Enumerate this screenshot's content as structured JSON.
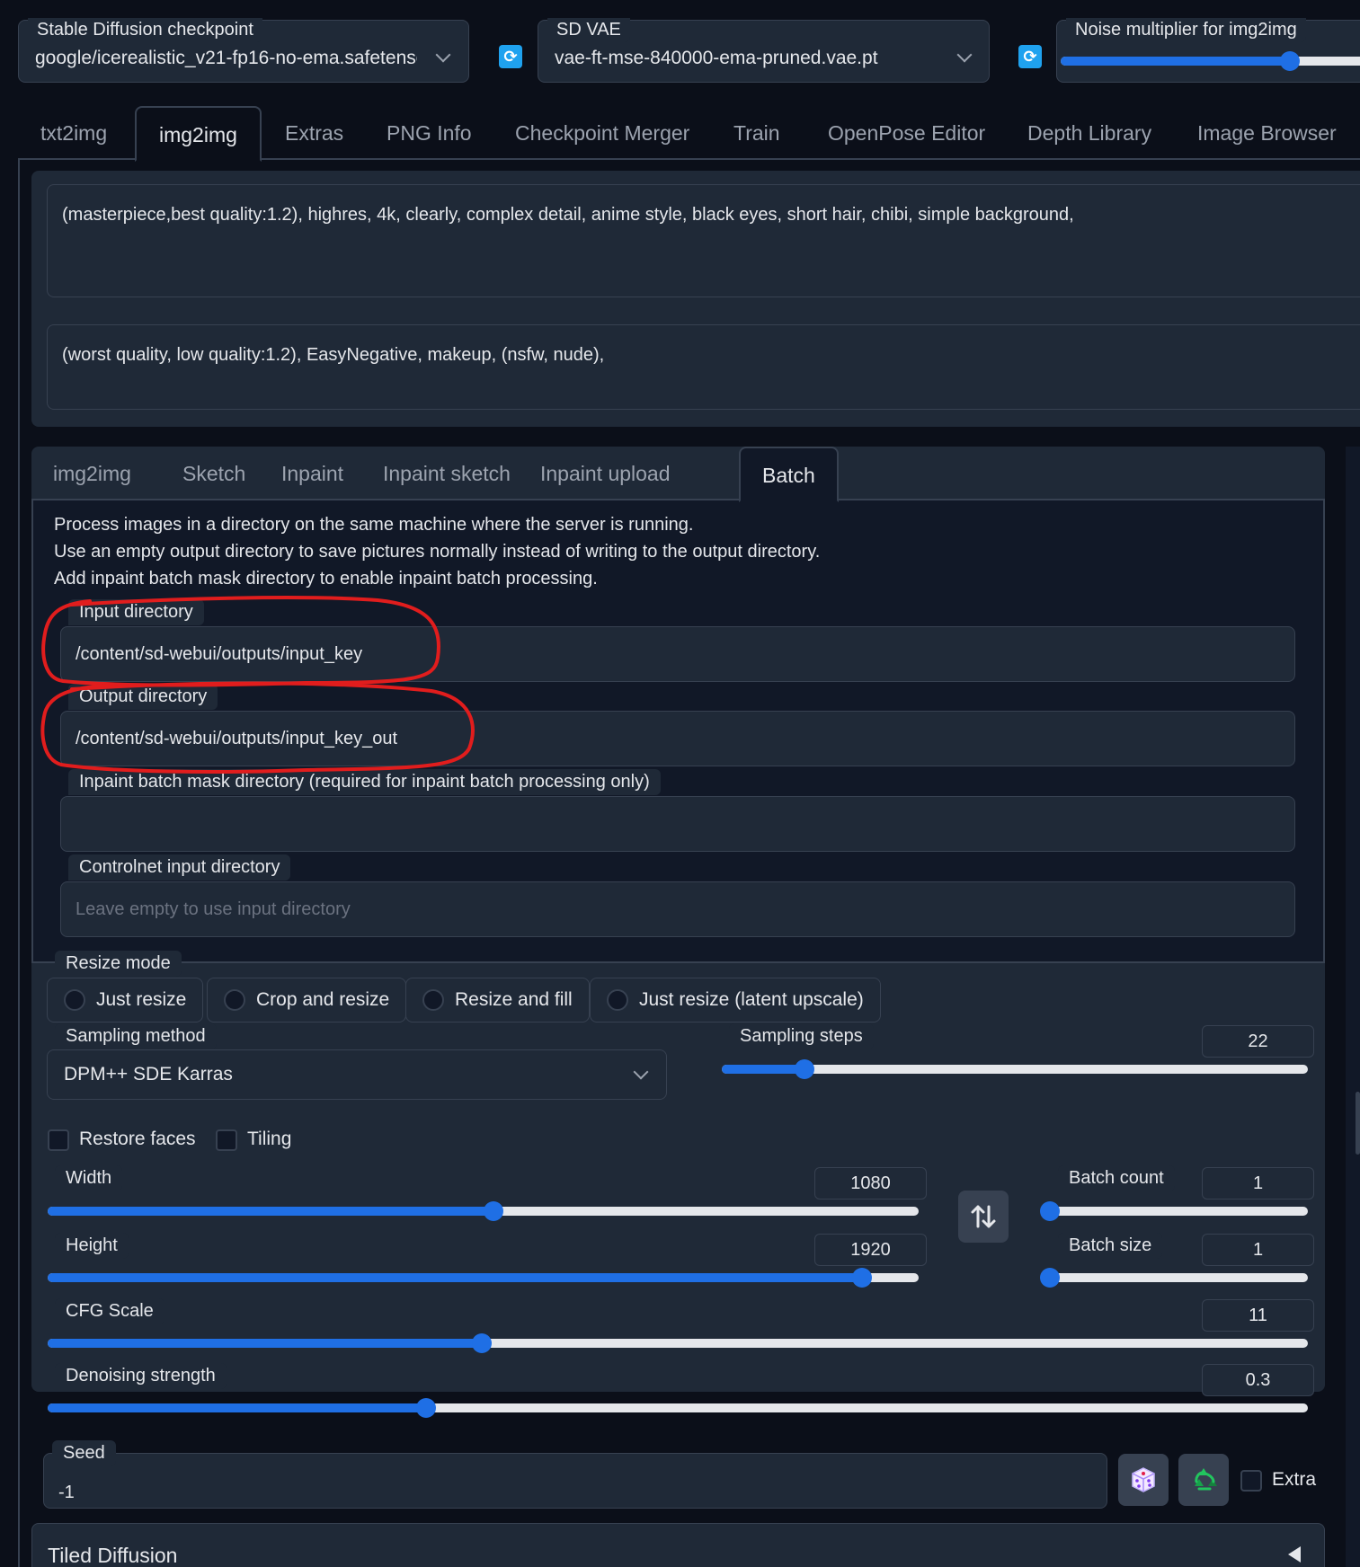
{
  "top": {
    "checkpoint_label": "Stable Diffusion checkpoint",
    "checkpoint_value": "google/icerealistic_v21-fp16-no-ema.safetensors",
    "vae_label": "SD VAE",
    "vae_value": "vae-ft-mse-840000-ema-pruned.vae.pt",
    "noise_label": "Noise multiplier for img2img",
    "noise_level": 0.75
  },
  "main_tabs": [
    "txt2img",
    "img2img",
    "Extras",
    "PNG Info",
    "Checkpoint Merger",
    "Train",
    "OpenPose Editor",
    "Depth Library",
    "Image Browser"
  ],
  "main_tab_active": "img2img",
  "prompts": {
    "positive": "(masterpiece,best quality:1.2), highres, 4k, clearly, complex detail, anime style, black eyes, short hair, chibi, simple background,",
    "negative": "(worst quality, low quality:1.2), EasyNegative, makeup, (nsfw, nude),"
  },
  "sub_tabs": [
    "img2img",
    "Sketch",
    "Inpaint",
    "Inpaint sketch",
    "Inpaint upload",
    "Batch"
  ],
  "sub_tab_active": "Batch",
  "batch": {
    "info": [
      "Process images in a directory on the same machine where the server is running.",
      "Use an empty output directory to save pictures normally instead of writing to the output directory.",
      "Add inpaint batch mask directory to enable inpaint batch processing."
    ],
    "input_label": "Input directory",
    "input_value": "/content/sd-webui/outputs/input_key",
    "output_label": "Output directory",
    "output_value": "/content/sd-webui/outputs/input_key_out",
    "mask_label": "Inpaint batch mask directory (required for inpaint batch processing only)",
    "mask_value": "",
    "controlnet_label": "Controlnet input directory",
    "controlnet_placeholder": "Leave empty to use input directory"
  },
  "resize_mode": {
    "label": "Resize mode",
    "options": [
      "Just resize",
      "Crop and resize",
      "Resize and fill",
      "Just resize (latent upscale)"
    ]
  },
  "sampling": {
    "method_label": "Sampling method",
    "method_value": "DPM++ SDE Karras",
    "steps_label": "Sampling steps",
    "steps_value": "22",
    "steps_min": 1,
    "steps_max": 150,
    "steps": 22
  },
  "checks": {
    "restore_faces": "Restore faces",
    "tiling": "Tiling",
    "extra": "Extra"
  },
  "width": {
    "label": "Width",
    "value": "1080",
    "num": 1080,
    "min": 64,
    "max": 2048
  },
  "height": {
    "label": "Height",
    "value": "1920",
    "num": 1920,
    "min": 64,
    "max": 2048
  },
  "batch_count": {
    "label": "Batch count",
    "value": "1",
    "num": 1,
    "min": 1,
    "max": 100
  },
  "batch_size": {
    "label": "Batch size",
    "value": "1",
    "num": 1,
    "min": 1,
    "max": 8
  },
  "cfg": {
    "label": "CFG Scale",
    "value": "11",
    "num": 11,
    "min": 1,
    "max": 30
  },
  "denoise": {
    "label": "Denoising strength",
    "value": "0.3",
    "num": 0.3,
    "min": 0,
    "max": 1
  },
  "seed": {
    "label": "Seed",
    "value": "-1"
  },
  "tiled_diffusion": {
    "label": "Tiled Diffusion"
  },
  "icons": {
    "refresh": "refresh-icon",
    "swap": "swap-icon",
    "dice": "dice-icon",
    "recycle": "recycle-icon",
    "collapse": "triangle-left-icon"
  },
  "colors": {
    "accent": "#1f6fe5",
    "refresh": "#1fa2ef",
    "annotation": "#e11d1d"
  }
}
